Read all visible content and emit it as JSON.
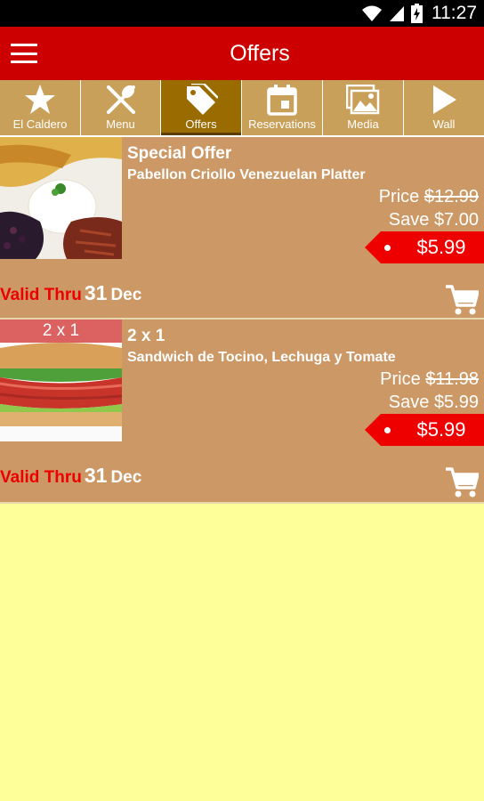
{
  "status_bar": {
    "time": "11:27"
  },
  "app_bar": {
    "title": "Offers"
  },
  "tabs": [
    {
      "label": "El Caldero",
      "icon": "star-icon",
      "active": false
    },
    {
      "label": "Menu",
      "icon": "fork-knife-icon",
      "active": false
    },
    {
      "label": "Offers",
      "icon": "tag-icon",
      "active": true
    },
    {
      "label": "Reservations",
      "icon": "calendar-icon",
      "active": false
    },
    {
      "label": "Media",
      "icon": "photos-icon",
      "active": false
    },
    {
      "label": "Wall",
      "icon": "play-icon",
      "active": false
    }
  ],
  "offers": [
    {
      "badge": "",
      "title": "Special Offer",
      "name": "Pabellon Criollo Venezuelan Platter",
      "price_label": "Price",
      "original_price": "$12.99",
      "save_label": "Save",
      "save_amount": "$7.00",
      "final_price": "$5.99",
      "valid_label": "Valid Thru",
      "valid_day": "31",
      "valid_month": "Dec"
    },
    {
      "badge": "2 x 1",
      "title": "2 x 1",
      "name": "Sandwich de Tocino, Lechuga y Tomate",
      "price_label": "Price",
      "original_price": "$11.98",
      "save_label": "Save",
      "save_amount": "$5.99",
      "final_price": "$5.99",
      "valid_label": "Valid Thru",
      "valid_day": "31",
      "valid_month": "Dec"
    }
  ],
  "colors": {
    "app_bar": "#cc0000",
    "tab_bar": "#c8a05a",
    "tab_active": "#9a6c00",
    "offer_bg": "#cc9966",
    "price_tag": "#ee0000",
    "page_bg": "#ffff99"
  }
}
